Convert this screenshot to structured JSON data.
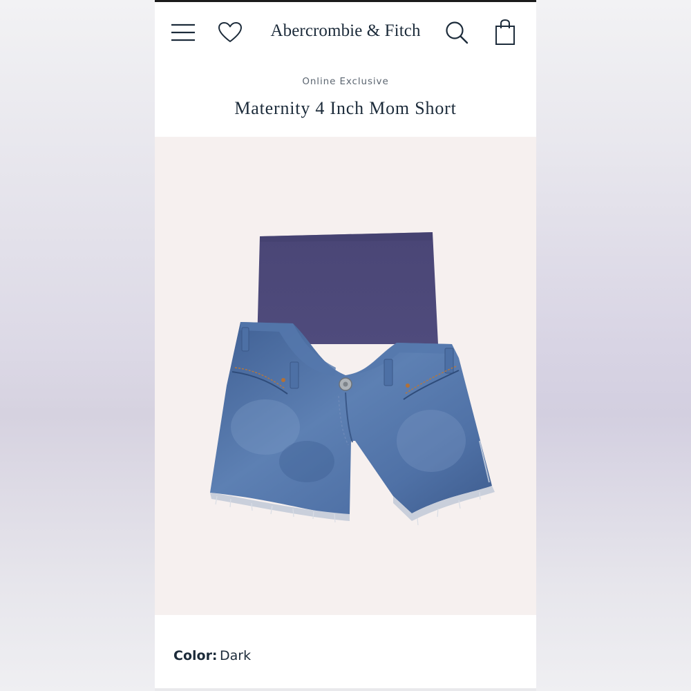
{
  "header": {
    "brand": "Abercrombie & Fitch",
    "icons": [
      "menu-icon",
      "heart-icon",
      "search-icon",
      "shopping-bag-icon"
    ]
  },
  "product": {
    "badge": "Online Exclusive",
    "title": "Maternity 4 Inch Mom Short",
    "image": "product-photo-maternity-denim-shorts",
    "color_label": "Color:",
    "color_value": "Dark"
  },
  "colors": {
    "text": "#1c2b3a",
    "image_bg": "#f6f0ef",
    "panel": "#4e4a7a",
    "denim": "#5073a6"
  }
}
